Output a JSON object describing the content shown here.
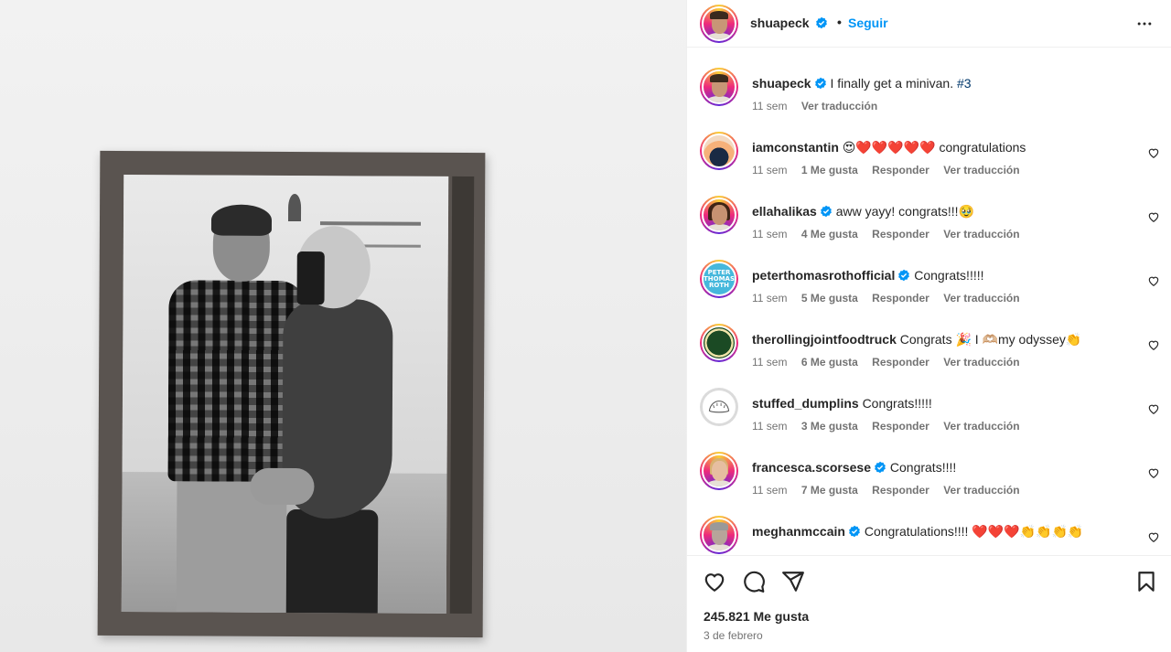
{
  "post": {
    "author": "shuapeck",
    "follow_label": "Seguir",
    "dot": "•"
  },
  "caption": {
    "user": "shuapeck",
    "text": "I finally get a minivan.",
    "hashtag": "#3",
    "time": "11 sem",
    "translate": "Ver traducción"
  },
  "comments": [
    {
      "user": "iamconstantin",
      "verified": false,
      "text": "😍❤️❤️❤️❤️❤️ congratulations",
      "time": "11 sem",
      "likes": "1 Me gusta",
      "reply": "Responder",
      "translate": "Ver traducción"
    },
    {
      "user": "ellahalikas",
      "verified": true,
      "text": "aww yayy! congrats!!!🥹",
      "time": "11 sem",
      "likes": "4 Me gusta",
      "reply": "Responder",
      "translate": "Ver traducción"
    },
    {
      "user": "peterthomasrothofficial",
      "verified": true,
      "text": "Congrats!!!!!",
      "time": "11 sem",
      "likes": "5 Me gusta",
      "reply": "Responder",
      "translate": "Ver traducción",
      "avatar_text": "PETER THOMAS ROTH"
    },
    {
      "user": "therollingjointfoodtruck",
      "verified": false,
      "text": "Congrats 🎉 I 🫶🏼my odyssey👏",
      "time": "11 sem",
      "likes": "6 Me gusta",
      "reply": "Responder",
      "translate": "Ver traducción"
    },
    {
      "user": "stuffed_dumplins",
      "verified": false,
      "text": "Congrats!!!!!",
      "time": "11 sem",
      "likes": "3 Me gusta",
      "reply": "Responder",
      "translate": "Ver traducción"
    },
    {
      "user": "francesca.scorsese",
      "verified": true,
      "text": "Congrats!!!!",
      "time": "11 sem",
      "likes": "7 Me gusta",
      "reply": "Responder",
      "translate": "Ver traducción"
    },
    {
      "user": "meghanmccain",
      "verified": true,
      "text": "Congratulations!!!! ❤️❤️❤️👏👏👏👏",
      "time": "",
      "likes": "",
      "reply": "",
      "translate": ""
    }
  ],
  "footer": {
    "likes": "245.821 Me gusta",
    "date": "3 de febrero"
  },
  "icons": {
    "verified": "verified-badge-icon",
    "more": "more-options-icon",
    "heart": "heart-icon",
    "comment": "comment-icon",
    "share": "share-icon",
    "save": "bookmark-icon"
  },
  "colors": {
    "accent": "#0095f6",
    "verified": "#0095f6",
    "meta": "#737373"
  }
}
